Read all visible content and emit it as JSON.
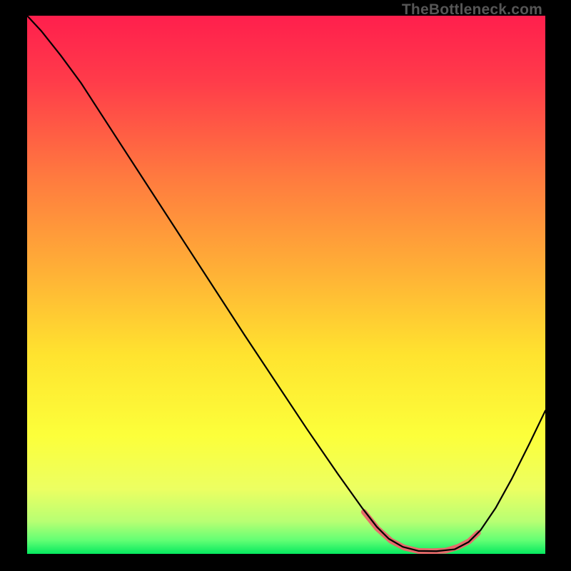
{
  "watermark": "TheBottleneck.com",
  "chart_data": {
    "type": "line",
    "title": "",
    "xlabel": "",
    "ylabel": "",
    "xlim": [
      0,
      100
    ],
    "ylim": [
      0,
      100
    ],
    "gradient_stops": [
      {
        "offset": 0.0,
        "color": "#ff1f4d"
      },
      {
        "offset": 0.12,
        "color": "#ff3b4a"
      },
      {
        "offset": 0.3,
        "color": "#ff7a3f"
      },
      {
        "offset": 0.48,
        "color": "#ffb236"
      },
      {
        "offset": 0.63,
        "color": "#ffe32f"
      },
      {
        "offset": 0.78,
        "color": "#fcff3a"
      },
      {
        "offset": 0.88,
        "color": "#ecff62"
      },
      {
        "offset": 0.94,
        "color": "#b7ff73"
      },
      {
        "offset": 0.975,
        "color": "#62ff74"
      },
      {
        "offset": 1.0,
        "color": "#06e95f"
      }
    ],
    "series": [
      {
        "name": "bottleneck-curve",
        "color": "#000000",
        "width": 2.2,
        "points": [
          {
            "x": 0.0,
            "y": 100.0
          },
          {
            "x": 2.7,
            "y": 97.2
          },
          {
            "x": 6.5,
            "y": 92.6
          },
          {
            "x": 10.4,
            "y": 87.5
          },
          {
            "x": 18.0,
            "y": 76.2
          },
          {
            "x": 30.0,
            "y": 58.4
          },
          {
            "x": 42.0,
            "y": 40.6
          },
          {
            "x": 54.0,
            "y": 23.2
          },
          {
            "x": 60.0,
            "y": 14.8
          },
          {
            "x": 64.6,
            "y": 8.6
          },
          {
            "x": 67.5,
            "y": 5.0
          },
          {
            "x": 69.8,
            "y": 2.8
          },
          {
            "x": 72.5,
            "y": 1.3
          },
          {
            "x": 75.5,
            "y": 0.55
          },
          {
            "x": 79.0,
            "y": 0.5
          },
          {
            "x": 82.5,
            "y": 0.85
          },
          {
            "x": 85.2,
            "y": 2.2
          },
          {
            "x": 87.5,
            "y": 4.4
          },
          {
            "x": 90.4,
            "y": 8.5
          },
          {
            "x": 93.5,
            "y": 13.9
          },
          {
            "x": 97.0,
            "y": 20.6
          },
          {
            "x": 100.0,
            "y": 26.6
          }
        ]
      },
      {
        "name": "floor-highlight",
        "color": "#e66a6a",
        "width": 8,
        "points": [
          {
            "x": 65.0,
            "y": 7.8
          },
          {
            "x": 67.6,
            "y": 4.7
          },
          {
            "x": 70.2,
            "y": 2.45
          },
          {
            "x": 72.8,
            "y": 1.15
          },
          {
            "x": 75.5,
            "y": 0.55
          },
          {
            "x": 78.2,
            "y": 0.5
          },
          {
            "x": 80.8,
            "y": 0.6
          },
          {
            "x": 83.2,
            "y": 1.3
          },
          {
            "x": 85.3,
            "y": 2.35
          },
          {
            "x": 87.0,
            "y": 3.9
          }
        ]
      }
    ]
  }
}
